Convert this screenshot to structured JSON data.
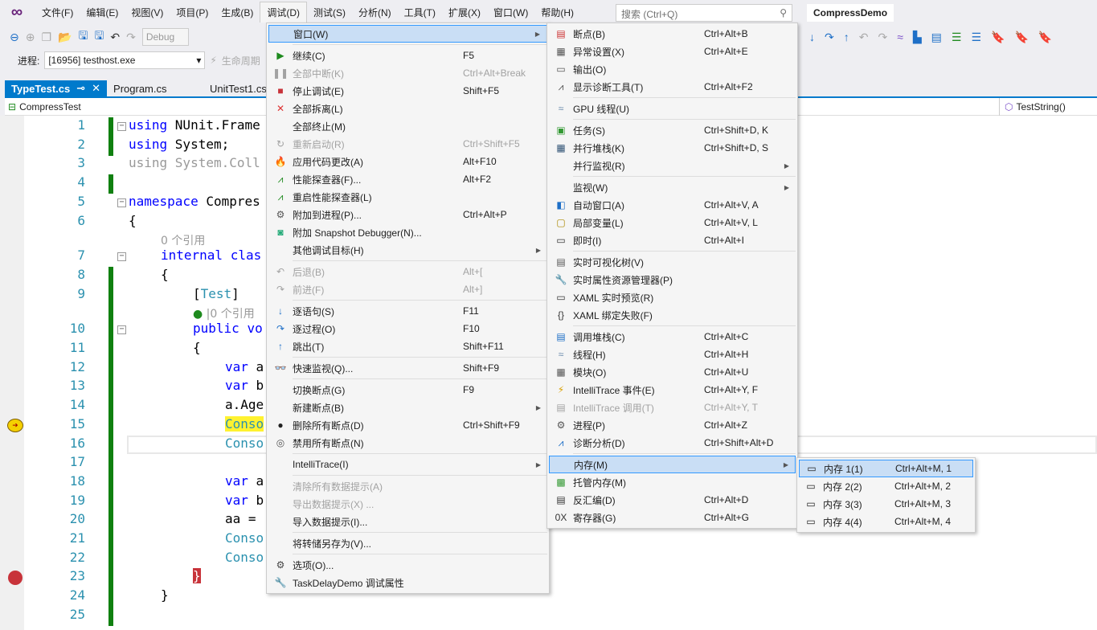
{
  "menubar": {
    "items": [
      "文件(F)",
      "编辑(E)",
      "视图(V)",
      "项目(P)",
      "生成(B)",
      "调试(D)",
      "测试(S)",
      "分析(N)",
      "工具(T)",
      "扩展(X)",
      "窗口(W)",
      "帮助(H)"
    ],
    "active": 5,
    "search_placeholder": "搜索 (Ctrl+Q)",
    "project": "CompressDemo"
  },
  "toolbar": {
    "config": "Debug",
    "process_label": "进程:",
    "process_value": "[16956] testhost.exe",
    "lifecycle": "生命周期"
  },
  "tabs": [
    {
      "label": "TypeTest.cs",
      "active": true
    },
    {
      "label": "Program.cs"
    },
    {
      "label": "UnitTest1.cs"
    }
  ],
  "nav": {
    "left": "CompressTest",
    "right": "TestString()"
  },
  "code": [
    {
      "n": "1",
      "fold": true,
      "chg": true,
      "ind": 0,
      "t": [
        [
          "using ",
          "kw"
        ],
        [
          "NUnit.Frame",
          "pl"
        ]
      ]
    },
    {
      "n": "2",
      "chg": true,
      "ind": 0,
      "t": [
        [
          "using ",
          "kw"
        ],
        [
          "System;",
          "pl"
        ]
      ]
    },
    {
      "n": "3",
      "ind": 0,
      "t": [
        [
          "using System.Coll",
          "gr"
        ]
      ]
    },
    {
      "n": "4",
      "chg": true,
      "ind": 0,
      "t": []
    },
    {
      "n": "5",
      "fold": true,
      "ind": 0,
      "t": [
        [
          "namespace ",
          "kw"
        ],
        [
          "Compres",
          "pl"
        ]
      ]
    },
    {
      "n": "6",
      "ind": 0,
      "t": [
        [
          "{",
          "pl"
        ]
      ]
    },
    {
      "lens": "0 个引用",
      "ind": 1
    },
    {
      "n": "7",
      "fold": true,
      "ind": 1,
      "t": [
        [
          "internal ",
          "kw"
        ],
        [
          "clas",
          "kw"
        ]
      ]
    },
    {
      "n": "8",
      "chg": true,
      "ind": 1,
      "t": [
        [
          "{",
          "pl"
        ]
      ]
    },
    {
      "n": "9",
      "chg": true,
      "ind": 2,
      "t": [
        [
          "[",
          "pl"
        ],
        [
          "Test",
          "ty"
        ],
        [
          "]",
          "pl"
        ]
      ]
    },
    {
      "lens": "|0 个引用",
      "check": true,
      "chg": true,
      "ind": 2
    },
    {
      "n": "10",
      "fold": true,
      "chg": true,
      "ind": 2,
      "t": [
        [
          "public ",
          "kw"
        ],
        [
          "vo",
          "kw"
        ]
      ]
    },
    {
      "n": "11",
      "chg": true,
      "ind": 2,
      "t": [
        [
          "{",
          "pl"
        ]
      ]
    },
    {
      "n": "12",
      "chg": true,
      "ind": 3,
      "t": [
        [
          "var ",
          "kw"
        ],
        [
          "a",
          "pl"
        ]
      ]
    },
    {
      "n": "13",
      "chg": true,
      "ind": 3,
      "t": [
        [
          "var ",
          "kw"
        ],
        [
          "b",
          "pl"
        ]
      ]
    },
    {
      "n": "14",
      "chg": true,
      "ind": 3,
      "t": [
        [
          "a.Age",
          "pl"
        ]
      ]
    },
    {
      "n": "15",
      "chg": true,
      "ind": 3,
      "cur": true,
      "t": [
        [
          "Conso",
          "ty"
        ]
      ]
    },
    {
      "n": "16",
      "chg": true,
      "ind": 3,
      "box": true,
      "t": [
        [
          "Conso",
          "ty"
        ]
      ]
    },
    {
      "n": "17",
      "chg": true,
      "ind": 3,
      "t": []
    },
    {
      "n": "18",
      "chg": true,
      "ind": 3,
      "t": [
        [
          "var ",
          "kw"
        ],
        [
          "a",
          "pl"
        ]
      ]
    },
    {
      "n": "19",
      "chg": true,
      "ind": 3,
      "t": [
        [
          "var ",
          "kw"
        ],
        [
          "b",
          "pl"
        ]
      ]
    },
    {
      "n": "20",
      "chg": true,
      "ind": 3,
      "t": [
        [
          "aa =",
          "pl"
        ]
      ]
    },
    {
      "n": "21",
      "chg": true,
      "ind": 3,
      "t": [
        [
          "Conso",
          "ty"
        ]
      ]
    },
    {
      "n": "22",
      "chg": true,
      "ind": 3,
      "t": [
        [
          "Conso",
          "ty"
        ]
      ]
    },
    {
      "n": "23",
      "chg": true,
      "ind": 2,
      "bp": true,
      "t": [
        [
          "}",
          "pl"
        ]
      ]
    },
    {
      "n": "24",
      "chg": true,
      "ind": 1,
      "t": [
        [
          "}",
          "pl"
        ]
      ]
    },
    {
      "n": "25",
      "chg": true,
      "ind": 0,
      "t": []
    }
  ],
  "debug_menu": [
    {
      "l": "窗口(W)",
      "sub": true,
      "sel": true
    },
    "-",
    {
      "l": "继续(C)",
      "s": "F5",
      "i": "▶",
      "c": "#1e8a1e"
    },
    {
      "l": "全部中断(K)",
      "s": "Ctrl+Alt+Break",
      "i": "❚❚",
      "d": true
    },
    {
      "l": "停止调试(E)",
      "s": "Shift+F5",
      "i": "■",
      "c": "#c8333a"
    },
    {
      "l": "全部拆离(L)",
      "i": "✕",
      "c": "#d33"
    },
    {
      "l": "全部终止(M)"
    },
    {
      "l": "重新启动(R)",
      "s": "Ctrl+Shift+F5",
      "i": "↻",
      "d": true
    },
    {
      "l": "应用代码更改(A)",
      "s": "Alt+F10",
      "i": "🔥",
      "c": "#d33"
    },
    {
      "l": "性能探查器(F)...",
      "s": "Alt+F2",
      "i": "⩘",
      "c": "#1e8a1e"
    },
    {
      "l": "重启性能探查器(L)",
      "i": "⩘",
      "c": "#1e8a1e"
    },
    {
      "l": "附加到进程(P)...",
      "s": "Ctrl+Alt+P",
      "i": "⚙",
      "c": "#555"
    },
    {
      "l": "附加 Snapshot Debugger(N)...",
      "i": "◙",
      "c": "#2a7"
    },
    {
      "l": "其他调试目标(H)",
      "sub": true
    },
    "-",
    {
      "l": "后退(B)",
      "s": "Alt+[",
      "i": "↶",
      "d": true
    },
    {
      "l": "前进(F)",
      "s": "Alt+]",
      "i": "↷",
      "d": true
    },
    "-",
    {
      "l": "逐语句(S)",
      "s": "F11",
      "i": "↓",
      "c": "#1e6fc7"
    },
    {
      "l": "逐过程(O)",
      "s": "F10",
      "i": "↷",
      "c": "#1e6fc7"
    },
    {
      "l": "跳出(T)",
      "s": "Shift+F11",
      "i": "↑",
      "c": "#1e6fc7"
    },
    "-",
    {
      "l": "快速监视(Q)...",
      "s": "Shift+F9",
      "i": "👓",
      "c": "#333"
    },
    "-",
    {
      "l": "切换断点(G)",
      "s": "F9"
    },
    {
      "l": "新建断点(B)",
      "sub": true
    },
    {
      "l": "删除所有断点(D)",
      "s": "Ctrl+Shift+F9",
      "i": "●",
      "c": "#222"
    },
    {
      "l": "禁用所有断点(N)",
      "i": "◎",
      "c": "#555"
    },
    "-",
    {
      "l": "IntelliTrace(I)",
      "sub": true
    },
    "-",
    {
      "l": "清除所有数据提示(A)",
      "d": true
    },
    {
      "l": "导出数据提示(X) ...",
      "d": true
    },
    {
      "l": "导入数据提示(I)..."
    },
    "-",
    {
      "l": "将转储另存为(V)..."
    },
    "-",
    {
      "l": "选项(O)...",
      "i": "⚙",
      "c": "#444"
    },
    {
      "l": "TaskDelayDemo 调试属性",
      "i": "🔧",
      "c": "#444"
    }
  ],
  "window_menu": [
    {
      "l": "断点(B)",
      "s": "Ctrl+Alt+B",
      "i": "▤",
      "c": "#c33"
    },
    {
      "l": "异常设置(X)",
      "s": "Ctrl+Alt+E",
      "i": "▦",
      "c": "#555"
    },
    {
      "l": "输出(O)",
      "i": "▭",
      "c": "#555"
    },
    {
      "l": "显示诊断工具(T)",
      "s": "Ctrl+Alt+F2",
      "i": "⩘",
      "c": "#555"
    },
    "-",
    {
      "l": "GPU 线程(U)",
      "i": "≈",
      "c": "#68a"
    },
    "-",
    {
      "l": "任务(S)",
      "s": "Ctrl+Shift+D, K",
      "i": "▣",
      "c": "#393"
    },
    {
      "l": "并行堆栈(K)",
      "s": "Ctrl+Shift+D, S",
      "i": "▦",
      "c": "#357"
    },
    {
      "l": "并行监视(R)",
      "sub": true
    },
    "-",
    {
      "l": "监视(W)",
      "sub": true
    },
    {
      "l": "自动窗口(A)",
      "s": "Ctrl+Alt+V, A",
      "i": "◧",
      "c": "#1e6fc7"
    },
    {
      "l": "局部变量(L)",
      "s": "Ctrl+Alt+V, L",
      "i": "▢",
      "c": "#a80"
    },
    {
      "l": "即时(I)",
      "s": "Ctrl+Alt+I",
      "i": "▭",
      "c": "#333"
    },
    "-",
    {
      "l": "实时可视化树(V)",
      "i": "▤",
      "c": "#555"
    },
    {
      "l": "实时属性资源管理器(P)",
      "i": "🔧",
      "c": "#1e6fc7"
    },
    {
      "l": "XAML 实时预览(R)",
      "i": "▭",
      "c": "#333"
    },
    {
      "l": "XAML 绑定失败(F)",
      "i": "{}",
      "c": "#333"
    },
    "-",
    {
      "l": "调用堆栈(C)",
      "s": "Ctrl+Alt+C",
      "i": "▤",
      "c": "#1e6fc7"
    },
    {
      "l": "线程(H)",
      "s": "Ctrl+Alt+H",
      "i": "≈",
      "c": "#68a"
    },
    {
      "l": "模块(O)",
      "s": "Ctrl+Alt+U",
      "i": "▦",
      "c": "#555"
    },
    {
      "l": "IntelliTrace 事件(E)",
      "s": "Ctrl+Alt+Y, F",
      "i": "⚡",
      "c": "#d9a000"
    },
    {
      "l": "IntelliTrace 调用(T)",
      "s": "Ctrl+Alt+Y, T",
      "i": "▤",
      "d": true
    },
    {
      "l": "进程(P)",
      "s": "Ctrl+Alt+Z",
      "i": "⚙",
      "c": "#555"
    },
    {
      "l": "诊断分析(D)",
      "s": "Ctrl+Shift+Alt+D",
      "i": "⩘",
      "c": "#1e6fc7"
    },
    "-",
    {
      "l": "内存(M)",
      "sub": true,
      "sel": true
    },
    {
      "l": "托管内存(M)",
      "i": "▩",
      "c": "#393"
    },
    {
      "l": "反汇编(D)",
      "s": "Ctrl+Alt+D",
      "i": "▤",
      "c": "#333"
    },
    {
      "l": "寄存器(G)",
      "s": "Ctrl+Alt+G",
      "i": "0X",
      "c": "#333"
    }
  ],
  "memory_menu": [
    {
      "l": "内存 1(1)",
      "s": "Ctrl+Alt+M, 1",
      "i": "▭",
      "sel": true
    },
    {
      "l": "内存 2(2)",
      "s": "Ctrl+Alt+M, 2",
      "i": "▭"
    },
    {
      "l": "内存 3(3)",
      "s": "Ctrl+Alt+M, 3",
      "i": "▭"
    },
    {
      "l": "内存 4(4)",
      "s": "Ctrl+Alt+M, 4",
      "i": "▭"
    }
  ]
}
